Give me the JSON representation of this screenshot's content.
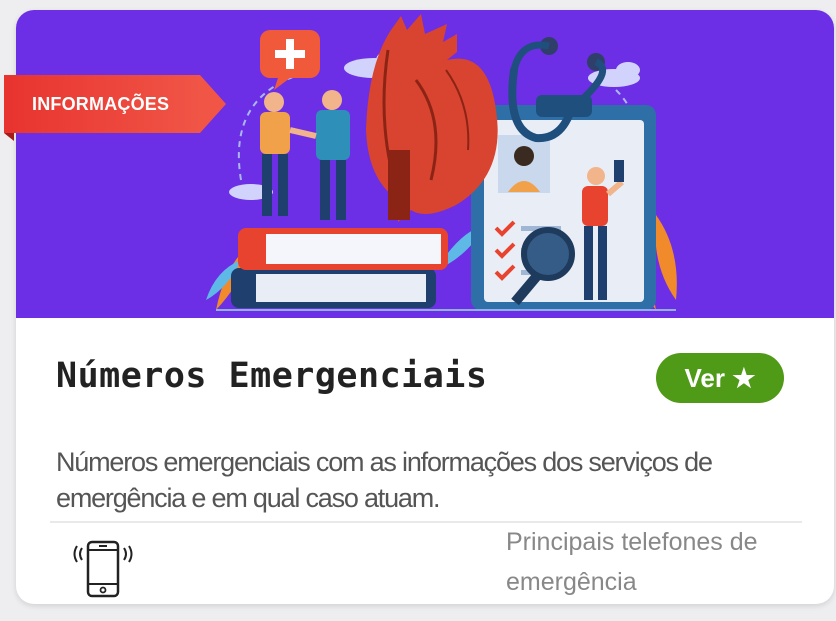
{
  "badge": {
    "label": "INFORMAÇÕES"
  },
  "card": {
    "title": "Números Emergenciais",
    "button_label": "Ver ★",
    "description": "Números emergenciais com as informações dos serviços de emergência e em qual caso atuam.",
    "footer_text": "Principais telefones de emergência"
  },
  "icons": {
    "footer": "smartphone-vibrate-icon",
    "hero": "medical-illustration"
  },
  "colors": {
    "hero_bg": "#6c2fe6",
    "badge": "#e8332f",
    "button": "#4f9a16"
  }
}
